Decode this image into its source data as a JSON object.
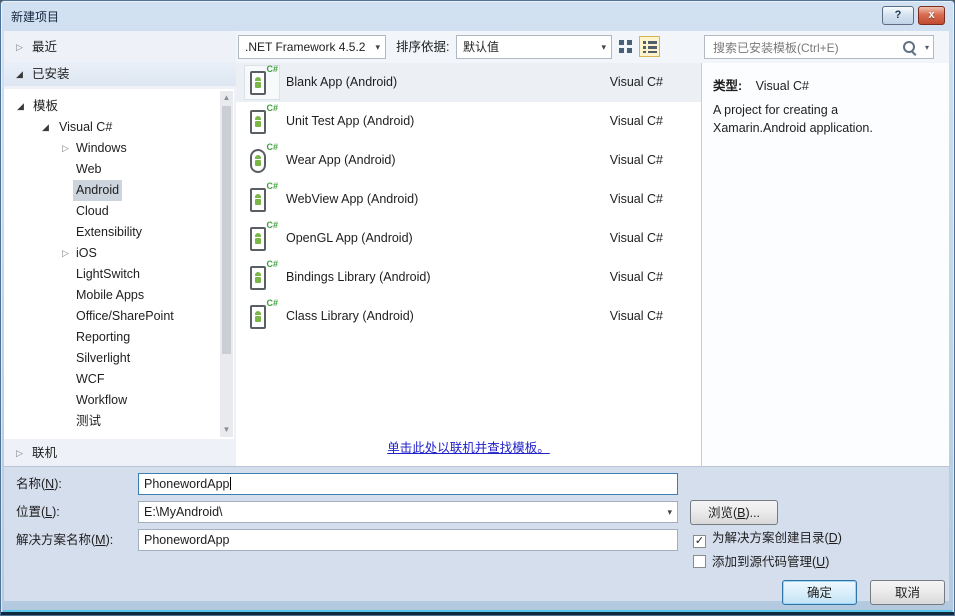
{
  "window": {
    "title": "新建项目",
    "help_label": "?",
    "close_label": "x"
  },
  "toolbar": {
    "framework_value": ".NET Framework 4.5.2",
    "sort_label": "排序依据:",
    "sort_value": "默认值",
    "search_placeholder": "搜索已安装模板(Ctrl+E)"
  },
  "nav": {
    "recent_label": "最近",
    "installed_label": "已安装",
    "online_label": "联机",
    "tree": [
      {
        "label": "模板"
      },
      {
        "label": "Visual C#"
      },
      {
        "label": "Windows"
      },
      {
        "label": "Web"
      },
      {
        "label": "Android",
        "selected": true
      },
      {
        "label": "Cloud"
      },
      {
        "label": "Extensibility"
      },
      {
        "label": "iOS"
      },
      {
        "label": "LightSwitch"
      },
      {
        "label": "Mobile Apps"
      },
      {
        "label": "Office/SharePoint"
      },
      {
        "label": "Reporting"
      },
      {
        "label": "Silverlight"
      },
      {
        "label": "WCF"
      },
      {
        "label": "Workflow"
      },
      {
        "label": "测试"
      }
    ]
  },
  "templates": {
    "badge": "C#",
    "items": [
      {
        "name": "Blank App (Android)",
        "language": "Visual C#",
        "selected": true
      },
      {
        "name": "Unit Test App (Android)",
        "language": "Visual C#"
      },
      {
        "name": "Wear App (Android)",
        "language": "Visual C#"
      },
      {
        "name": "WebView App (Android)",
        "language": "Visual C#"
      },
      {
        "name": "OpenGL App (Android)",
        "language": "Visual C#"
      },
      {
        "name": "Bindings Library (Android)",
        "language": "Visual C#"
      },
      {
        "name": "Class Library (Android)",
        "language": "Visual C#"
      }
    ],
    "online_link": "单击此处以联机并查找模板。"
  },
  "info": {
    "type_label": "类型:",
    "type_value": "Visual C#",
    "description": "A project for creating a Xamarin.Android application."
  },
  "form": {
    "name_label": {
      "prefix": "名称(",
      "key": "N",
      "suffix": "):"
    },
    "name_value": "PhonewordApp",
    "location_label": {
      "prefix": "位置(",
      "key": "L",
      "suffix": "):"
    },
    "location_value": "E:\\MyAndroid\\",
    "solution_label": {
      "prefix": "解决方案名称(",
      "key": "M",
      "suffix": "):"
    },
    "solution_value": "PhonewordApp",
    "browse_label": {
      "prefix": "浏览(",
      "key": "B",
      "suffix": ")..."
    },
    "checkbox_dir": {
      "prefix": "为解决方案创建目录(",
      "key": "D",
      "suffix": ")",
      "checked": true,
      "check_glyph": "✓"
    },
    "checkbox_source": {
      "prefix": "添加到源代码管理(",
      "key": "U",
      "suffix": ")",
      "checked": false
    },
    "ok_label": "确定",
    "cancel_label": "取消"
  },
  "colors": {
    "close_button_red": "#c14b31",
    "selection_gray_blue": "#ccd4dd",
    "link_blue": "#2222cc",
    "frame_blue": "#b3c9df",
    "android_green": "#7ab648",
    "csharp_green": "#3e9e3e"
  }
}
